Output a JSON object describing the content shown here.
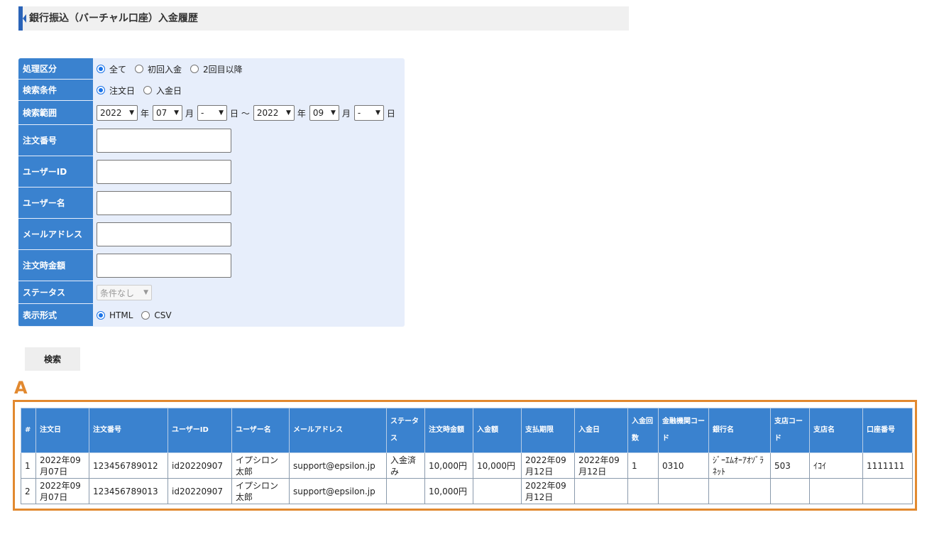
{
  "header": {
    "title": "銀行振込（バーチャル口座）入金履歴"
  },
  "form": {
    "process_label": "処理区分",
    "process_options": [
      "全て",
      "初回入金",
      "2回目以降"
    ],
    "condition_label": "検索条件",
    "condition_options": [
      "注文日",
      "入金日"
    ],
    "range_label": "検索範囲",
    "range": {
      "from_year": "2022",
      "from_month": "07",
      "from_day": "-",
      "to_year": "2022",
      "to_month": "09",
      "to_day": "-",
      "year_unit": "年",
      "month_unit": "月",
      "day_unit": "日",
      "tilde": "日 ～"
    },
    "order_no_label": "注文番号",
    "user_id_label": "ユーザーID",
    "user_name_label": "ユーザー名",
    "email_label": "メールアドレス",
    "amount_label": "注文時金額",
    "status_label": "ステータス",
    "status_value": "条件なし",
    "format_label": "表示形式",
    "format_options": [
      "HTML",
      "CSV"
    ]
  },
  "search_button": "検索",
  "section_label": "A",
  "table": {
    "headers": [
      "#",
      "注文日",
      "注文番号",
      "ユーザーID",
      "ユーザー名",
      "メールアドレス",
      "ステータス",
      "注文時金額",
      "入金額",
      "支払期限",
      "入金日",
      "入金回数",
      "金融機関コード",
      "銀行名",
      "支店コード",
      "支店名",
      "口座番号"
    ],
    "rows": [
      [
        "1",
        "2022年09月07日",
        "123456789012",
        "id20220907",
        "イプシロン太郎",
        "support@epsilon.jp",
        "入金済み",
        "10,000円",
        "10,000円",
        "2022年09月12日",
        "2022年09月12日",
        "1",
        "0310",
        "ｼﾞｰｴﾑｵｰｱｵｿﾞﾗﾈｯﾄ",
        "503",
        "ｲｺｲ",
        "1111111"
      ],
      [
        "2",
        "2022年09月07日",
        "123456789013",
        "id20220907",
        "イプシロン太郎",
        "support@epsilon.jp",
        "",
        "10,000円",
        "",
        "2022年09月12日",
        "",
        "",
        "",
        "",
        "",
        "",
        ""
      ]
    ]
  }
}
